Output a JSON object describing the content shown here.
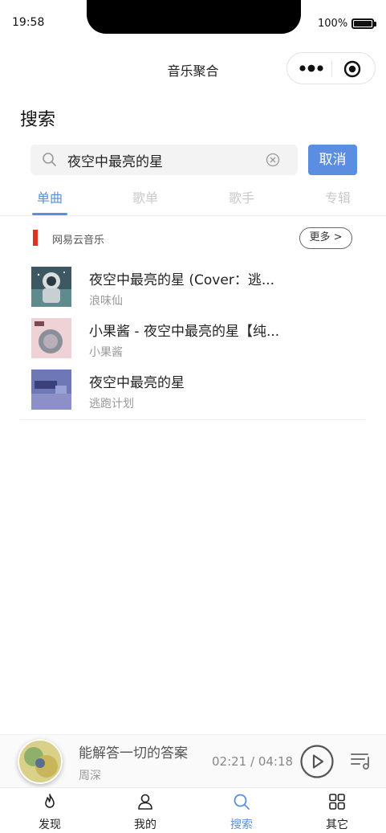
{
  "status_bar": {
    "time": "19:58",
    "battery": "100%"
  },
  "nav": {
    "title": "音乐聚合"
  },
  "search": {
    "heading": "搜索",
    "query": "夜空中最亮的星",
    "cancel_label": "取消"
  },
  "tabs": [
    {
      "label": "单曲",
      "active": true
    },
    {
      "label": "歌单",
      "active": false
    },
    {
      "label": "歌手",
      "active": false
    },
    {
      "label": "专辑",
      "active": false
    }
  ],
  "source": {
    "name": "网易云音乐",
    "more_label": "更多 >",
    "accent_color": "#e0321e"
  },
  "songs": [
    {
      "title": "夜空中最亮的星 (Cover：逃...",
      "artist": "浪味仙"
    },
    {
      "title": "小果酱 - 夜空中最亮的星【纯...",
      "artist": "小果酱"
    },
    {
      "title": "夜空中最亮的星",
      "artist": "逃跑计划"
    }
  ],
  "player": {
    "title": "能解答一切的答案",
    "artist": "周深",
    "time": "02:21 / 04:18"
  },
  "tabbar": [
    {
      "label": "发现",
      "icon": "flame-icon",
      "active": false
    },
    {
      "label": "我的",
      "icon": "user-icon",
      "active": false
    },
    {
      "label": "搜索",
      "icon": "search-icon",
      "active": true
    },
    {
      "label": "其它",
      "icon": "grid-icon",
      "active": false
    }
  ],
  "colors": {
    "accent": "#5b8ee0",
    "source_bar": "#e0321e"
  }
}
